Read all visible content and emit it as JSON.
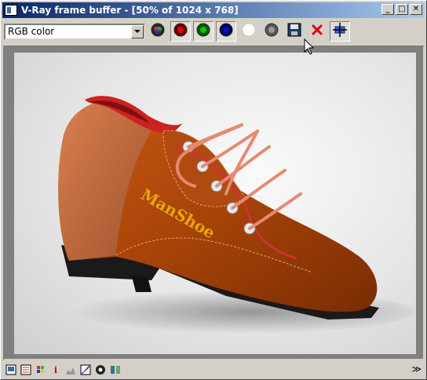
{
  "window": {
    "title": "V-Ray frame buffer - [50% of 1024 x 768]",
    "minimize_symbol": "_",
    "maximize_symbol": "□",
    "close_symbol": "✕"
  },
  "toolbar": {
    "channel_select": {
      "value": "RGB color"
    },
    "tools": [
      {
        "name": "switch-to-rgb",
        "icon": "rgb-orb-icon"
      },
      {
        "name": "red-channel",
        "icon": "red-orb-icon"
      },
      {
        "name": "green-channel",
        "icon": "green-orb-icon"
      },
      {
        "name": "blue-channel",
        "icon": "blue-orb-icon"
      },
      {
        "name": "alpha-channel",
        "icon": "white-orb-icon"
      },
      {
        "name": "monochrome",
        "icon": "gray-orb-icon"
      },
      {
        "name": "save-image",
        "icon": "floppy-disk-icon"
      },
      {
        "name": "clear-image",
        "icon": "red-x-icon"
      },
      {
        "name": "track-mouse",
        "icon": "crosshair-icon"
      }
    ]
  },
  "render": {
    "brand_text": "ManShoe"
  },
  "statusbar": {
    "icons": [
      "frame-icon",
      "history-icon",
      "color-correction-icon",
      "info-icon",
      "levels-icon",
      "curve-icon",
      "lens-icon",
      "compare-icon"
    ],
    "info_glyph": "i",
    "expand_glyph": "≫"
  },
  "colors": {
    "title_active": "#0a246a",
    "title_gradient_end": "#a6caf0",
    "window_face": "#d4d0c8",
    "shoe_leather": "#b04a10",
    "shoe_collar": "#c8693a",
    "brand_text": "#e6a800",
    "sole": "#1a1a1a",
    "lining": "#cc2222",
    "lace": "#e58a70"
  }
}
